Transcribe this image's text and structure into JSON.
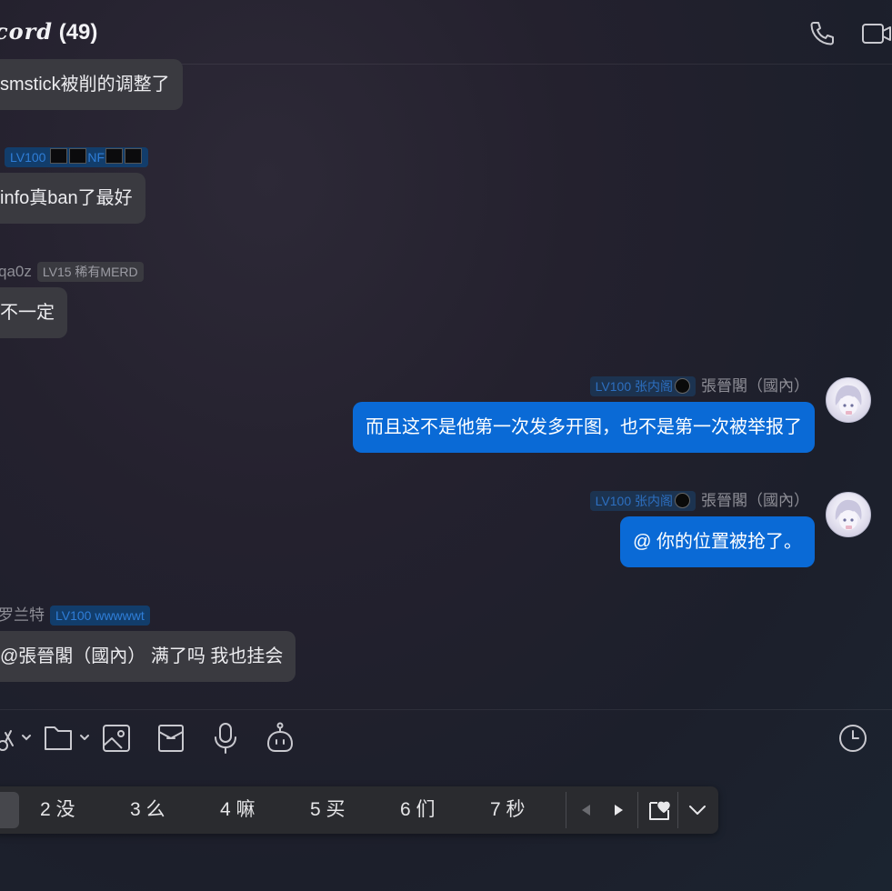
{
  "header": {
    "title_brand": "cord",
    "member_count": "(49)",
    "call_icon": "phone-icon",
    "video_icon": "video-camera-icon"
  },
  "messages": [
    {
      "text": "smstick被削的调整了"
    },
    {
      "badge": "LV100",
      "badge_tail": "NF",
      "text": "info真ban了最好"
    },
    {
      "sender": "qa0z",
      "badge": "LV15 稀有MERD",
      "text": "不一定"
    },
    {
      "sender": "張晉閣（國內）",
      "badge": "LV100 张内阁",
      "text": "而且这不是他第一次发多开图，也不是第一次被举报了"
    },
    {
      "sender": "張晉閣（國內）",
      "badge": "LV100 张内阁",
      "text": "@ 你的位置被抢了。"
    },
    {
      "sender": "罗兰特",
      "badge": "LV100 wwwwwt",
      "text": "@張晉閣（國內） 满了吗 我也挂会"
    }
  ],
  "toolbar": {
    "icons": [
      "scissors-icon",
      "folder-icon",
      "image-icon",
      "red-packet-icon",
      "microphone-icon",
      "robot-icon",
      "history-clock-icon"
    ]
  },
  "ime": {
    "candidates": [
      "2 没",
      "3 么",
      "4 嘛",
      "5 买",
      "6 们",
      "7 秒"
    ],
    "icons": [
      "prev-page-icon",
      "next-page-icon",
      "favorite-icon",
      "expand-icon"
    ]
  },
  "colors": {
    "accent": "#0a6ad6",
    "bubble_in": "#3a3a40",
    "badge_blue": "#123d6b"
  }
}
